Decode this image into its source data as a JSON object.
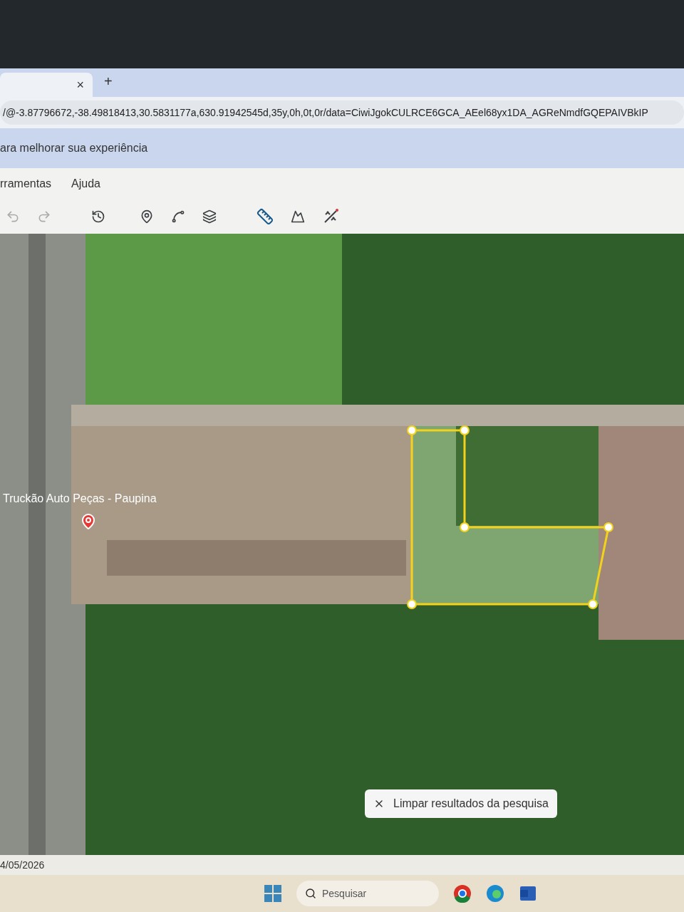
{
  "browser": {
    "tab_close": "×",
    "new_tab": "+",
    "address": "/@-3.87796672,-38.49818413,30.5831177a,630.91942545d,35y,0h,0t,0r/data=CiwiJgokCULRCE6GCA_AEel68yx1DA_AGReNmdfGQEPAIVBkIP",
    "info_bar": "ara melhorar sua experiência"
  },
  "menu": [
    "rramentas",
    "Ajuda"
  ],
  "map": {
    "place_label": "Truckão Auto Peças - Paupina",
    "clear_search": "Limpar resultados da pesquisa"
  },
  "status_date": "4/05/2026",
  "taskbar": {
    "search_placeholder": "Pesquisar"
  }
}
